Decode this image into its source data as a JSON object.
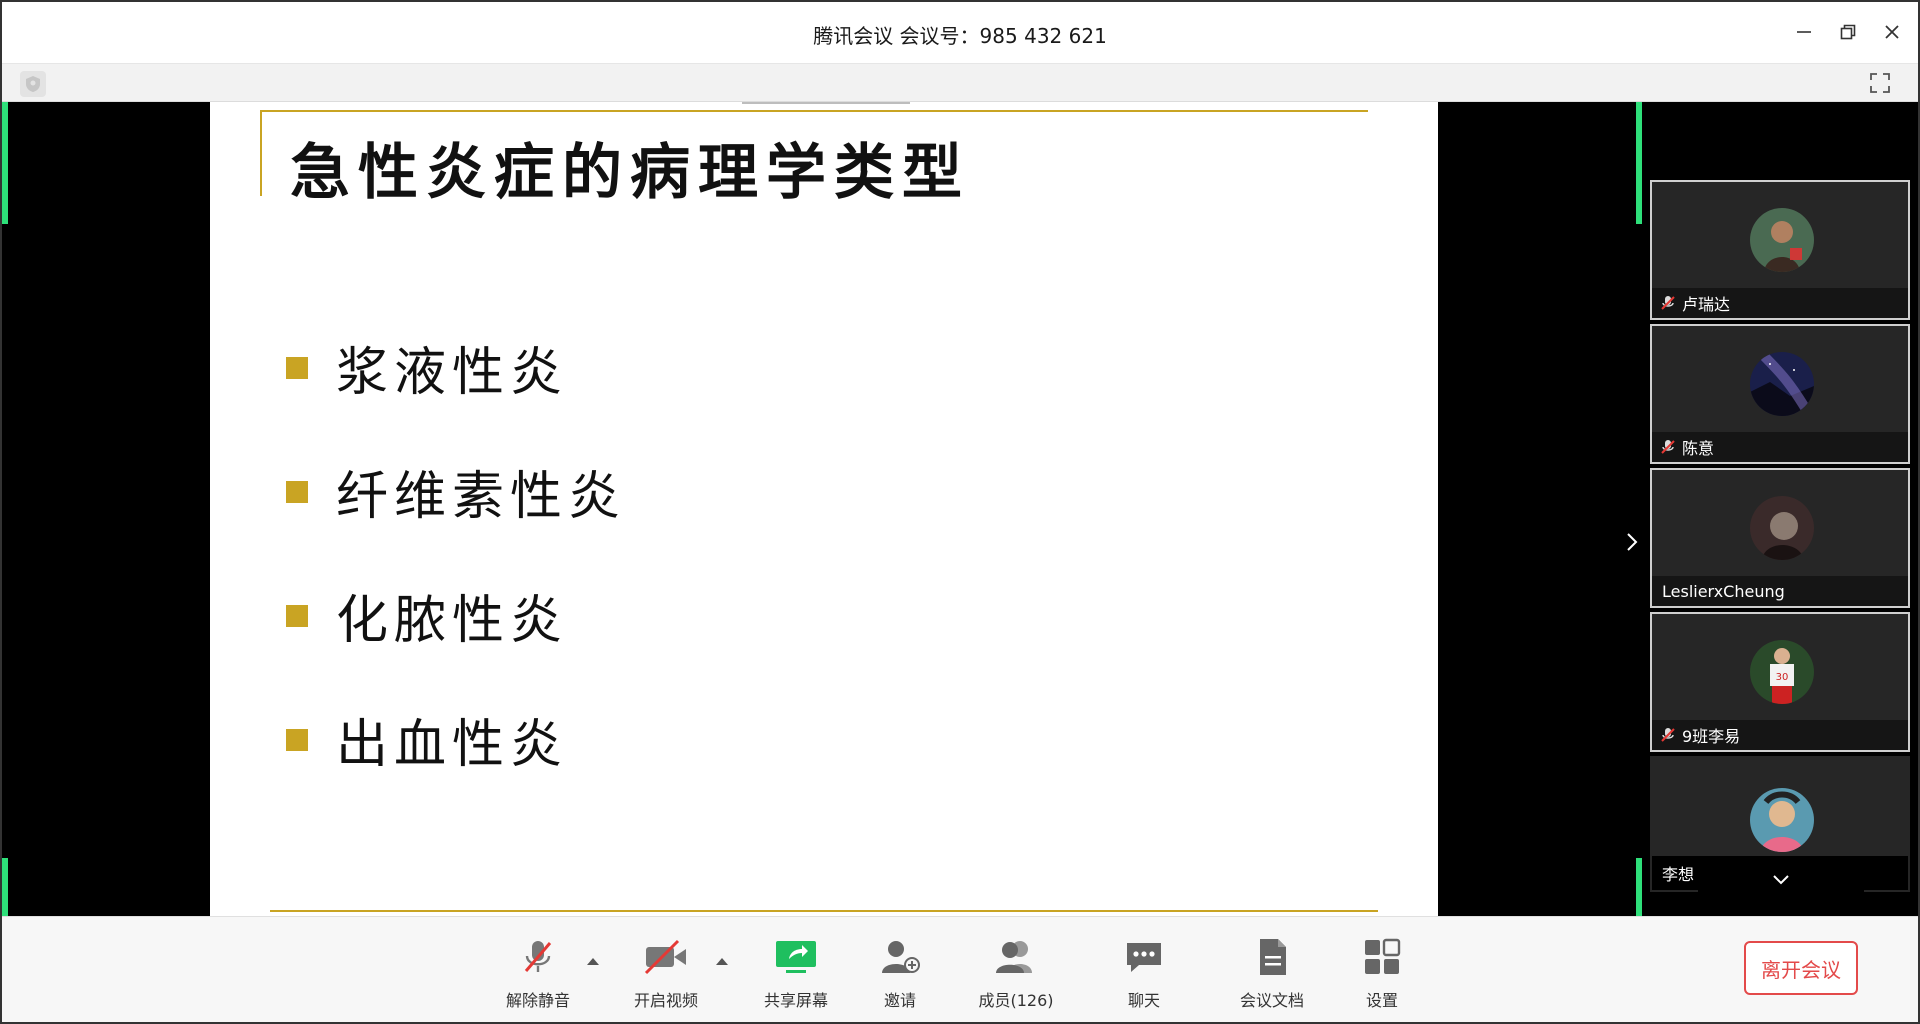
{
  "window": {
    "title": "腾讯会议 会议号：985 432 621"
  },
  "slide": {
    "title": "急性炎症的病理学类型",
    "bullets": [
      "浆液性炎",
      "纤维素性炎",
      "化脓性炎",
      "出血性炎"
    ],
    "accent_color": "#c9a423"
  },
  "participants": [
    {
      "name": "卢瑞达",
      "muted": true,
      "avatar": "man-portrait"
    },
    {
      "name": "陈意",
      "muted": true,
      "avatar": "night-sky"
    },
    {
      "name": "LeslierxCheung",
      "muted": false,
      "avatar": "dark-portrait"
    },
    {
      "name": "9班李易",
      "muted": true,
      "avatar": "football-player"
    },
    {
      "name": "李想",
      "muted": false,
      "avatar": "child-photo"
    }
  ],
  "toolbar": {
    "unmute_label": "解除静音",
    "video_label": "开启视频",
    "share_label": "共享屏幕",
    "invite_label": "邀请",
    "members_label": "成员(126)",
    "chat_label": "聊天",
    "docs_label": "会议文档",
    "settings_label": "设置",
    "leave_label": "离开会议"
  },
  "colors": {
    "active_green": "#2ee07a",
    "leave_red": "#e34a4a",
    "mute_red": "#e53935"
  }
}
